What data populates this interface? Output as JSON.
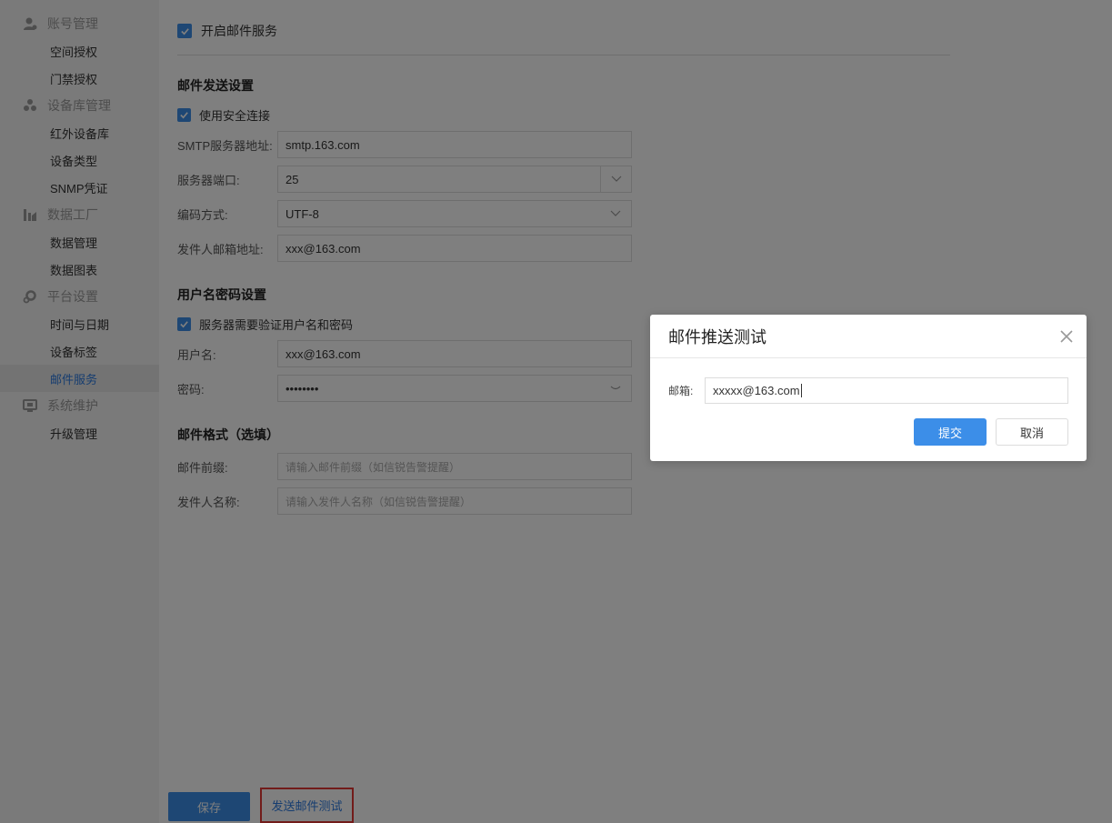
{
  "sidebar": {
    "groups": [
      {
        "title": "账号管理",
        "icon": "user-icon",
        "items": [
          "空间授权",
          "门禁授权"
        ]
      },
      {
        "title": "设备库管理",
        "icon": "device-library-icon",
        "items": [
          "红外设备库",
          "设备类型",
          "SNMP凭证"
        ]
      },
      {
        "title": "数据工厂",
        "icon": "data-factory-icon",
        "items": [
          "数据管理",
          "数据图表"
        ]
      },
      {
        "title": "平台设置",
        "icon": "gear-icon",
        "items": [
          "时间与日期",
          "设备标签",
          "邮件服务"
        ]
      },
      {
        "title": "系统维护",
        "icon": "monitor-icon",
        "items": [
          "升级管理"
        ]
      }
    ],
    "active_item": "邮件服务"
  },
  "main": {
    "enable_label": "开启邮件服务",
    "send_section": {
      "title": "邮件发送设置",
      "secure_label": "使用安全连接",
      "smtp_label": "SMTP服务器地址:",
      "smtp_value": "smtp.163.com",
      "port_label": "服务器端口:",
      "port_value": "25",
      "encoding_label": "编码方式:",
      "encoding_value": "UTF-8",
      "sender_email_label": "发件人邮箱地址:",
      "sender_email_value": "xxx@163.com"
    },
    "auth_section": {
      "title": "用户名密码设置",
      "auth_label": "服务器需要验证用户名和密码",
      "username_label": "用户名:",
      "username_value": "xxx@163.com",
      "password_label": "密码:",
      "password_value": "••••••••"
    },
    "format_section": {
      "title": "邮件格式（选填）",
      "prefix_label": "邮件前缀:",
      "prefix_placeholder": "请输入邮件前缀（如信锐告警提醒）",
      "sender_name_label": "发件人名称:",
      "sender_name_placeholder": "请输入发件人名称（如信锐告警提醒）"
    },
    "save_label": "保存",
    "test_label": "发送邮件测试"
  },
  "dialog": {
    "title": "邮件推送测试",
    "email_label": "邮箱:",
    "email_value": "xxxxx@163.com",
    "submit_label": "提交",
    "cancel_label": "取消"
  },
  "colors": {
    "accent": "#3c8ee8",
    "highlight_border": "#e53935"
  }
}
